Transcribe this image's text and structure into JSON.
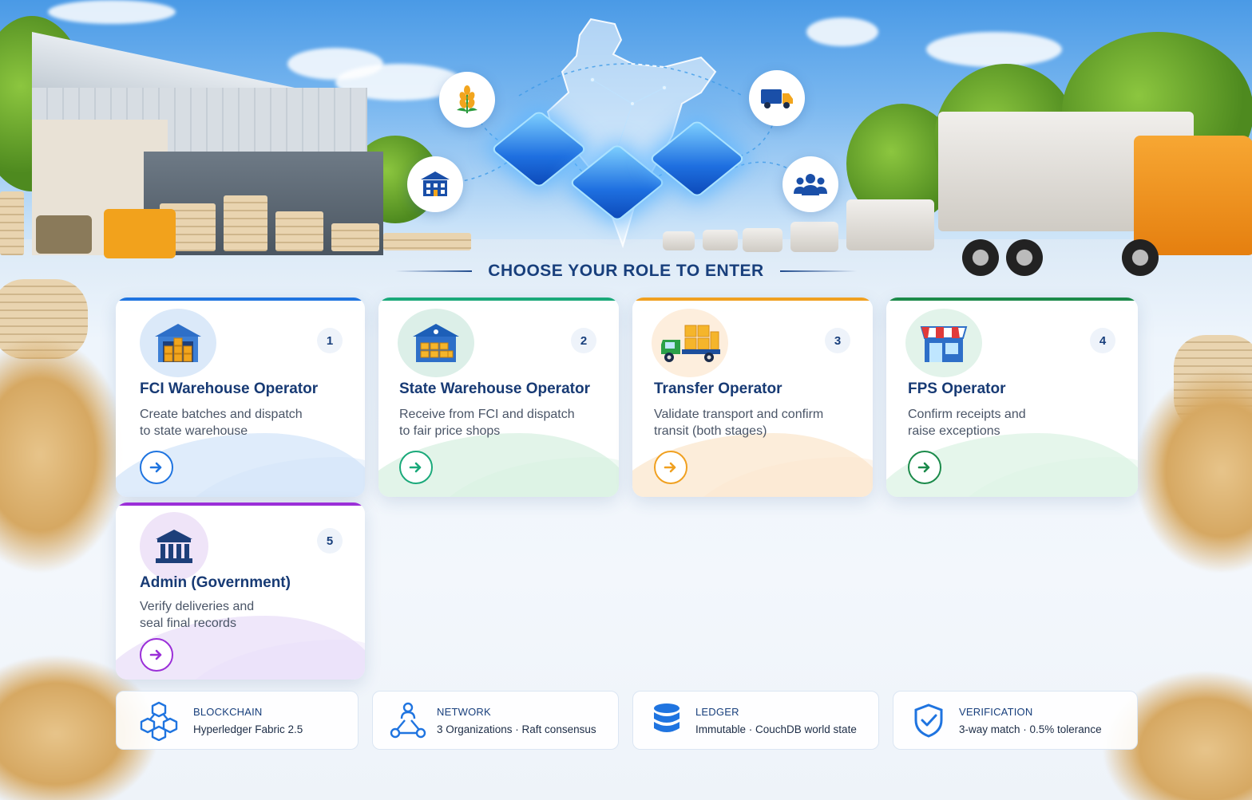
{
  "heading": "CHOOSE YOUR ROLE TO ENTER",
  "roles": [
    {
      "number": "1",
      "title": "FCI Warehouse Operator",
      "desc_line1": "Create batches and dispatch",
      "desc_line2": "to state warehouse",
      "icon": "warehouse-icon",
      "accent": "#1f74e0"
    },
    {
      "number": "2",
      "title": "State Warehouse Operator",
      "desc_line1": "Receive from FCI and dispatch",
      "desc_line2": "to fair price shops",
      "icon": "state-warehouse-icon",
      "accent": "#1aa97a"
    },
    {
      "number": "3",
      "title": "Transfer Operator",
      "desc_line1": "Validate transport and confirm",
      "desc_line2": "transit (both stages)",
      "icon": "truck-icon",
      "accent": "#f0a020"
    },
    {
      "number": "4",
      "title": "FPS Operator",
      "desc_line1": "Confirm receipts and",
      "desc_line2": "raise exceptions",
      "icon": "shop-icon",
      "accent": "#1b8a4a"
    },
    {
      "number": "5",
      "title": "Admin (Government)",
      "desc_line1": "Verify deliveries and",
      "desc_line2": "seal final records",
      "icon": "government-building-icon",
      "accent": "#9b2fd8"
    }
  ],
  "info": [
    {
      "key": "BLOCKCHAIN",
      "value": "Hyperledger Fabric 2.5",
      "icon": "blockchain-icon"
    },
    {
      "key": "NETWORK",
      "value": "3 Organizations · Raft consensus",
      "icon": "network-icon"
    },
    {
      "key": "LEDGER",
      "value": "Immutable · CouchDB world state",
      "icon": "database-icon"
    },
    {
      "key": "VERIFICATION",
      "value": "3-way match · 0.5% tolerance",
      "icon": "shield-check-icon"
    }
  ],
  "colors": {
    "primary": "#183f7c",
    "blue": "#1f74e0",
    "green": "#1aa97a",
    "orange": "#f0a020",
    "fps_green": "#1b8a4a",
    "purple": "#9b2fd8"
  }
}
